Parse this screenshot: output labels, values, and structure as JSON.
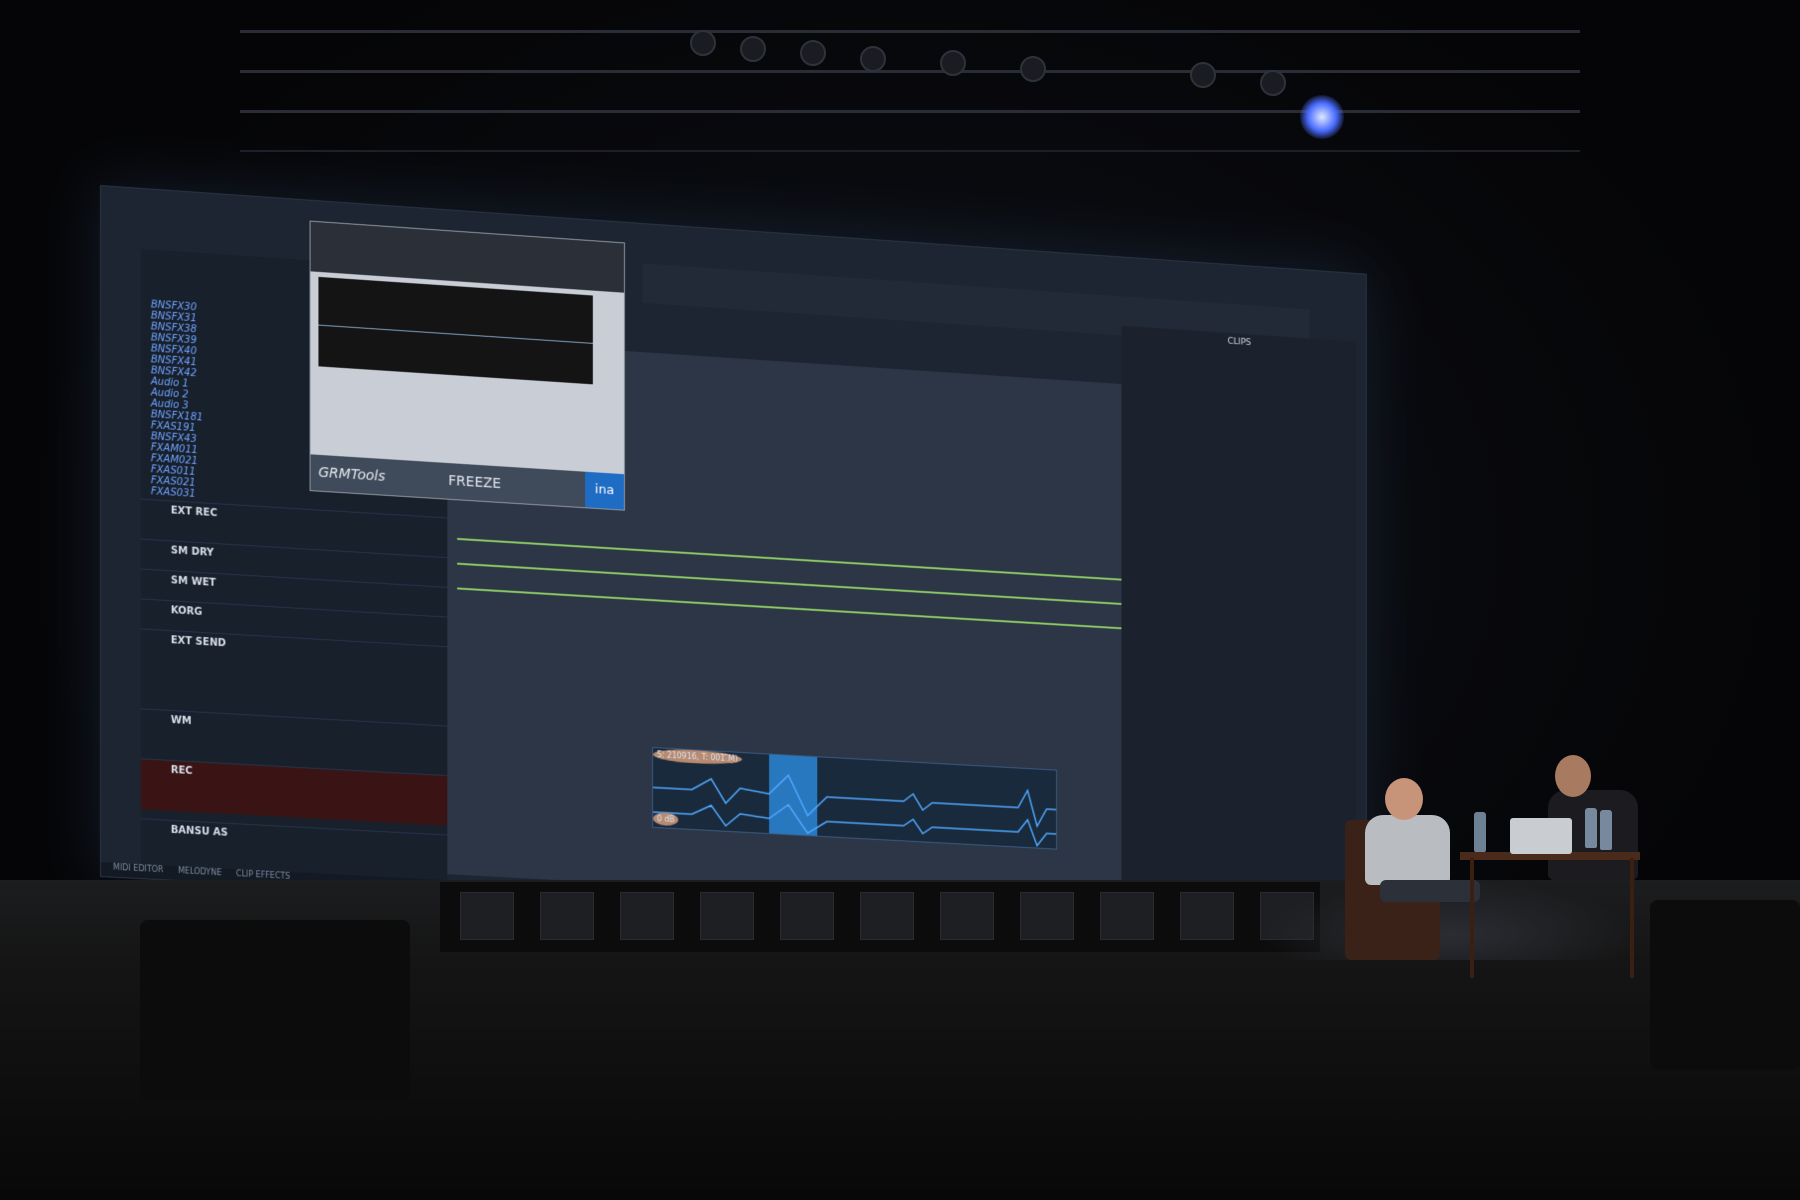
{
  "plugin": {
    "brand": "GRMTools",
    "module": "FREEZE",
    "vendor_badge": "ina"
  },
  "clip": {
    "name": "210916_001-05 (SM)",
    "info": "S: 210916, T: 001",
    "gain": "0 dB"
  },
  "clips_panel": {
    "title": "CLIPS"
  },
  "mixer": {
    "strips": [
      "EXT REC",
      "SM DRY",
      "SM WET",
      "KORG",
      "EXT SEND",
      "WM",
      "REC",
      "BANSU AS"
    ]
  },
  "tracks": [
    "BNSFX30",
    "BNSFX31",
    "BNSFX38",
    "BNSFX39",
    "BNSFX40",
    "BNSFX41",
    "BNSFX42",
    "Audio 1",
    "Audio 2",
    "Audio 3",
    "BNSFX181",
    "FXAS191",
    "BNSFX43",
    "FXAM011",
    "FXAM021",
    "FXAS011",
    "FXAS021",
    "FXAS031"
  ],
  "bottom_tabs": [
    "MIDI EDITOR",
    "MELODYNE",
    "CLIP EFFECTS"
  ]
}
